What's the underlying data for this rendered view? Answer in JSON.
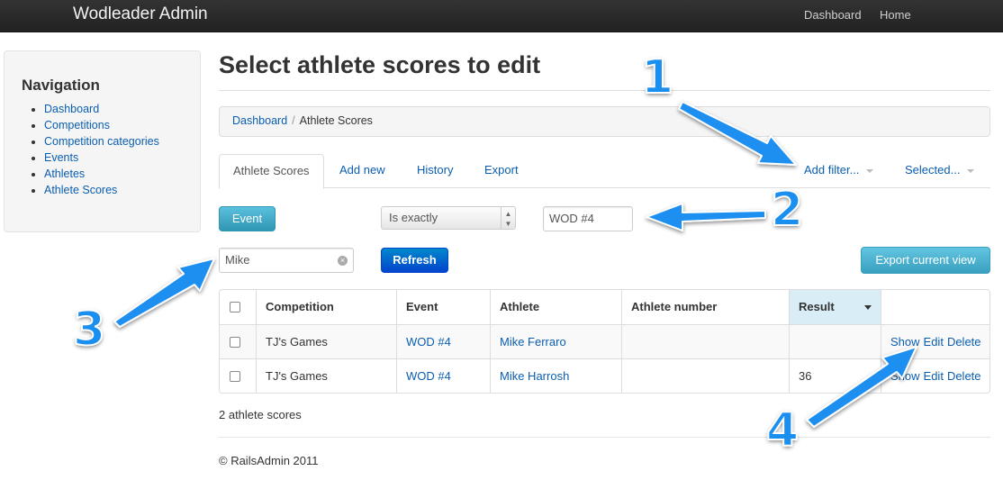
{
  "topbar": {
    "brand": "Wodleader Admin",
    "nav": [
      "Dashboard",
      "Home"
    ]
  },
  "sidebar": {
    "heading": "Navigation",
    "items": [
      "Dashboard",
      "Competitions",
      "Competition categories",
      "Events",
      "Athletes",
      "Athlete Scores"
    ]
  },
  "page": {
    "title": "Select athlete scores to edit"
  },
  "breadcrumb": {
    "home": "Dashboard",
    "separator": "/",
    "current": "Athlete Scores"
  },
  "tabs": {
    "active": "Athlete Scores",
    "add_new": "Add new",
    "history": "History",
    "export": "Export",
    "add_filter": "Add filter...",
    "selected": "Selected..."
  },
  "filter": {
    "field_button": "Event",
    "operator": "Is exactly",
    "value": "WOD #4",
    "search_value": "Mike",
    "refresh": "Refresh",
    "export_view": "Export current view"
  },
  "table": {
    "columns": [
      "Competition",
      "Event",
      "Athlete",
      "Athlete number",
      "Result"
    ],
    "rows": [
      {
        "competition": "TJ's Games",
        "event": "WOD #4",
        "athlete": "Mike Ferraro",
        "athlete_number": "",
        "result": ""
      },
      {
        "competition": "TJ's Games",
        "event": "WOD #4",
        "athlete": "Mike Harrosh",
        "athlete_number": "",
        "result": "36"
      }
    ],
    "actions": {
      "show": "Show",
      "edit": "Edit",
      "delete": "Delete"
    }
  },
  "summary": "2 athlete scores",
  "footer": "© RailsAdmin 2011",
  "callouts": [
    "1",
    "2",
    "3",
    "4"
  ],
  "colors": {
    "topbar": "#222222",
    "link": "#0a5eb0",
    "primary": "#0055cc",
    "info": "#2f96b4",
    "callout": "#1a8ff0"
  }
}
